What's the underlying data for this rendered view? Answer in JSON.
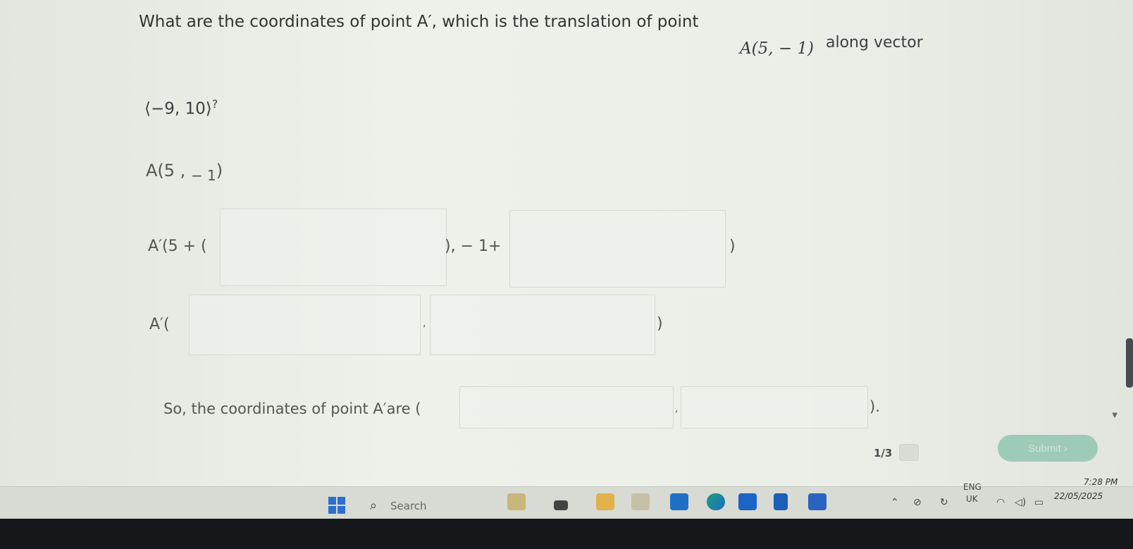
{
  "question": {
    "text": "What are the coordinates of point A′, which is the translation of point",
    "point": "A(5, − 1)",
    "suffix": "along vector",
    "vector": "⟨−9, 10⟩",
    "question_mark": "?"
  },
  "step1": {
    "prefix": "A(5 , ",
    "y": "− 1",
    "close": ")"
  },
  "step2": {
    "label": "A′(5 + (",
    "middle": "), − 1+",
    "close": ")"
  },
  "step3": {
    "label": "A′(",
    "comma": ",",
    "close": ")"
  },
  "final": {
    "text": "So, the coordinates of point A′are (",
    "comma": ",",
    "close": ")."
  },
  "footer": {
    "progress": "1/3",
    "submit_label": "Submit  ›"
  },
  "taskbar": {
    "search_label": "Search",
    "lang_top": "ENG",
    "lang_bottom": "UK",
    "time": "7:28 PM",
    "date": "22/05/2025",
    "icon_names": [
      "windows-start-icon",
      "search-icon",
      "file-explorer-icon",
      "edge-browser-icon",
      "store-icon",
      "app-icon"
    ]
  },
  "colors": {
    "submit_bg": "#9ecab8",
    "win_blue": "#2c6fd1",
    "edge_green": "#1c9f7a",
    "edge_blue": "#1b6cc5"
  }
}
